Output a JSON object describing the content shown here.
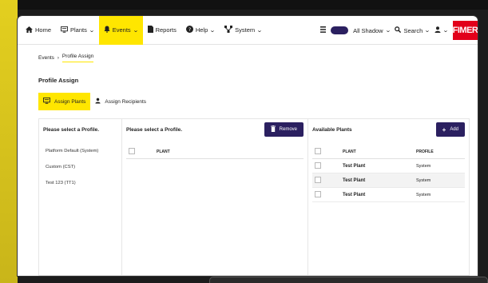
{
  "navbar": {
    "items": [
      {
        "label": "Home",
        "icon": "home-icon",
        "dropdown": false,
        "active": false
      },
      {
        "label": "Plants",
        "icon": "monitor-icon",
        "dropdown": true,
        "active": false
      },
      {
        "label": "Events",
        "icon": "bell-icon",
        "dropdown": true,
        "active": true
      },
      {
        "label": "Reports",
        "icon": "document-icon",
        "dropdown": false,
        "active": false
      },
      {
        "label": "Help",
        "icon": "help-icon",
        "dropdown": true,
        "active": false
      },
      {
        "label": "System",
        "icon": "network-icon",
        "dropdown": true,
        "active": false
      }
    ],
    "account": "All Shadow",
    "search": "Search",
    "brand": "FIMER"
  },
  "breadcrumb": {
    "parent": "Events",
    "separator": "›",
    "current": "Profile Assign"
  },
  "page": {
    "title": "Profile Assign"
  },
  "tabs": [
    {
      "label": "Assign Plants",
      "icon": "monitor-icon",
      "active": true
    },
    {
      "label": "Assign Recipients",
      "icon": "user-icon",
      "active": false
    }
  ],
  "profiles_panel": {
    "title": "Please select a Profile.",
    "items": [
      "Platform Default (System)",
      "Custom (CST)",
      "Test 123 (TT1)"
    ]
  },
  "assigned_panel": {
    "title": "Please select a Profile.",
    "button": "Remove",
    "column_plant": "PLANT"
  },
  "available_panel": {
    "title": "Available Plants",
    "button": "Add",
    "columns": {
      "plant": "PLANT",
      "profile": "PROFILE"
    },
    "rows": [
      {
        "plant": "Test Plant",
        "profile": "System"
      },
      {
        "plant": "Test Plant",
        "profile": "System"
      },
      {
        "plant": "Test Plant",
        "profile": "System"
      }
    ]
  },
  "colors": {
    "accent": "#ffe600",
    "primary": "#2b2060",
    "brand": "#e2001a"
  }
}
